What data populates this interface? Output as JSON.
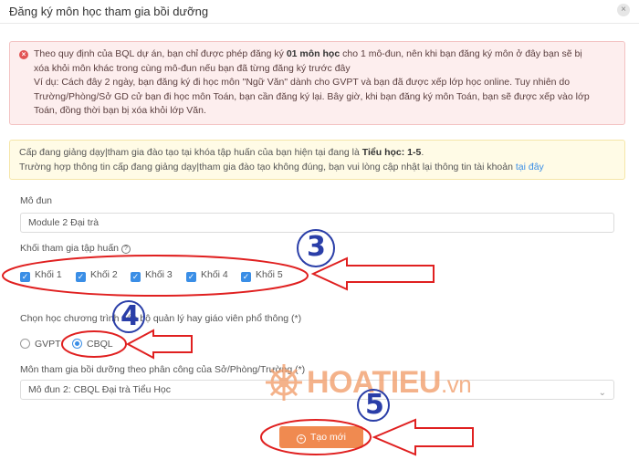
{
  "header": {
    "title": "Đăng ký môn học tham gia bồi dưỡng",
    "close_icon": "×"
  },
  "alert_error": {
    "line1_pre": "Theo quy định của BQL dự án, bạn chỉ được phép đăng ký ",
    "line1_bold": "01 môn học",
    "line1_post": " cho 1 mô-đun, nên khi bạn đăng ký môn ở đây bạn sẽ bị",
    "line2": "xóa khỏi môn khác trong cùng mô-đun nếu bạn đã từng đăng ký trước đây",
    "line3": "Ví dụ: Cách đây 2 ngày, bạn đăng ký đi học môn \"Ngữ Văn\" dành cho GVPT và bạn đã được xếp lớp học online. Tuy nhiên do",
    "line4": "Trường/Phòng/Sở GD cử bạn đi học môn Toán, bạn cần đăng ký lại. Bây giờ, khi bạn đăng ký môn Toán, bạn sẽ được xếp vào lớp",
    "line5": "Toán, đồng thời bạn bị xóa khỏi lớp Văn."
  },
  "alert_warn": {
    "line1_pre": "Cấp đang giảng dạy|tham gia đào tạo tại khóa tập huấn của bạn hiện tại đang là ",
    "line1_bold": "Tiểu học: 1-5",
    "line1_post": ".",
    "line2_pre": "Trường hợp thông tin cấp đang giảng dạy|tham gia đào tạo không đúng, bạn vui lòng cập nhật lại thông tin tài khoản ",
    "line2_link": "tại đây"
  },
  "module": {
    "label": "Mô đun",
    "value": "Module 2 Đại trà"
  },
  "grades": {
    "label": "Khối tham gia tập huấn",
    "items": [
      "Khối 1",
      "Khối 2",
      "Khối 3",
      "Khối 4",
      "Khối 5"
    ]
  },
  "program": {
    "label": "Chọn học chương trình cán bộ quản lý hay giáo viên phổ thông (*)",
    "options": [
      "GVPT",
      "CBQL"
    ],
    "selected": "CBQL"
  },
  "subject": {
    "label": "Môn tham gia bồi dưỡng theo phân công của Sở/Phòng/Trường (*)",
    "value": "Mô đun 2: CBQL Đại trà Tiểu Học"
  },
  "submit": {
    "label": "Tạo mới"
  },
  "watermark": {
    "main": "HOATIEU",
    "suffix": ".vn"
  },
  "annotations": {
    "n3": "3",
    "n4": "4",
    "n5": "5",
    "color": "#e02020",
    "num_color": "#2a3ea8"
  }
}
